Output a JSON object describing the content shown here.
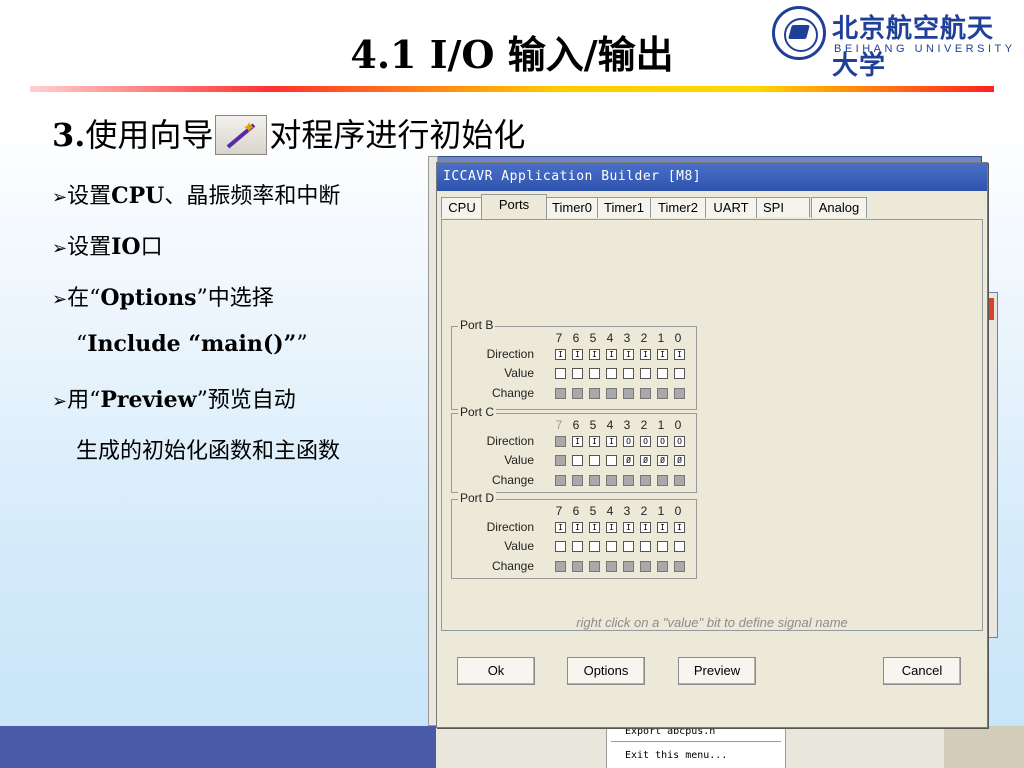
{
  "slide": {
    "title": "4.1 I/O 输入/输出",
    "logo": {
      "cn": "北京航空航天大学",
      "en": "BEIHANG UNIVERSITY"
    },
    "subtitle_num": "3.",
    "subtitle_pre": "使用向导",
    "subtitle_post": "对程序进行初始化",
    "bullets": [
      {
        "arrow": "➢",
        "a": "设置",
        "b": "CPU",
        "c": "、晶振频率和中断"
      },
      {
        "arrow": "➢",
        "a": "设置",
        "b": "IO",
        "c": "口"
      },
      {
        "arrow": "➢",
        "a": "在“",
        "b": "Options",
        "c": "”中选择"
      },
      {
        "arrow": "",
        "a": "“",
        "b": "Include “main()”",
        "c": "”"
      },
      {
        "arrow": "➢",
        "a": "用“",
        "b": "Preview",
        "c": "”预览自动"
      },
      {
        "arrow": "",
        "a": "生成的初始化函数和主函数",
        "b": "",
        "c": ""
      }
    ]
  },
  "menu": {
    "item1": "Export abcpus.h",
    "item2": "Exit this menu..."
  },
  "dialog": {
    "title": "ICCAVR Application Builder [M8]",
    "tabs": [
      "CPU",
      "Ports",
      "Timer0",
      "Timer1",
      "Timer2",
      "UART",
      "SPI",
      "Analog"
    ],
    "active_tab": "Ports",
    "row_labels": {
      "direction": "Direction",
      "value": "Value",
      "change": "Change"
    },
    "ports": [
      {
        "name": "Port B",
        "bits_enabled": [
          true,
          true,
          true,
          true,
          true,
          true,
          true,
          true
        ],
        "direction": [
          "I",
          "I",
          "I",
          "I",
          "I",
          "I",
          "I",
          "I"
        ],
        "value": [
          "",
          "",
          "",
          "",
          "",
          "",
          "",
          ""
        ],
        "change_enabled": false
      },
      {
        "name": "Port C",
        "bits_enabled": [
          false,
          true,
          true,
          true,
          true,
          true,
          true,
          true
        ],
        "direction": [
          "",
          "I",
          "I",
          "I",
          "O",
          "O",
          "O",
          "O"
        ],
        "value": [
          "",
          "",
          "",
          "",
          "Ø",
          "Ø",
          "Ø",
          "Ø"
        ],
        "change_enabled": false
      },
      {
        "name": "Port D",
        "bits_enabled": [
          true,
          true,
          true,
          true,
          true,
          true,
          true,
          true
        ],
        "direction": [
          "I",
          "I",
          "I",
          "I",
          "I",
          "I",
          "I",
          "I"
        ],
        "value": [
          "",
          "",
          "",
          "",
          "",
          "",
          "",
          ""
        ],
        "change_enabled": false
      }
    ],
    "bit_numbers": [
      "7",
      "6",
      "5",
      "4",
      "3",
      "2",
      "1",
      "0"
    ],
    "hint": "right click on a \"value\" bit to define signal name",
    "buttons": {
      "ok": "Ok",
      "options": "Options",
      "preview": "Preview",
      "cancel": "Cancel"
    }
  }
}
